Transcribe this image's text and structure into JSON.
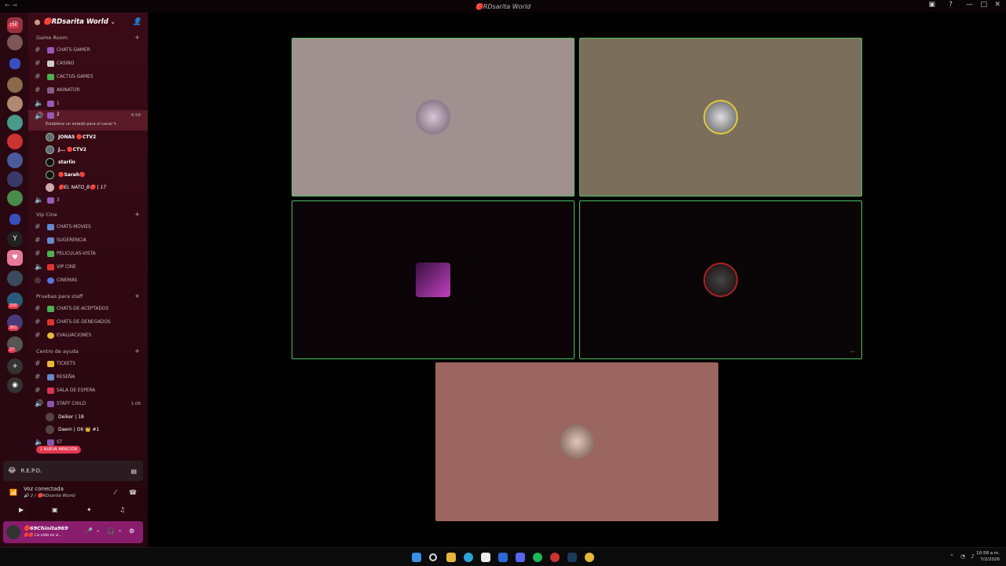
{
  "window": {
    "title": "🔴RDsarita World",
    "nav": "← →"
  },
  "server_rail": {
    "badges": [
      "156",
      "5",
      "330",
      "361",
      "27"
    ]
  },
  "sidebar": {
    "server_name": "🔴RDsarita World",
    "categories": [
      {
        "name": "Game Room",
        "channels": [
          {
            "name": "CHATS-GAMER",
            "type": "text",
            "color": "#9b59b6"
          },
          {
            "name": "CASINO",
            "type": "text",
            "color": "#cccccc"
          },
          {
            "name": "CACTUS-GAMES",
            "type": "text",
            "color": "#4caf50"
          },
          {
            "name": "AKINATOR",
            "type": "text",
            "color": "#8a5a8a"
          },
          {
            "name": "1",
            "type": "voice",
            "color": "#9b59b6"
          },
          {
            "name": "2",
            "type": "voice",
            "color": "#9b59b6",
            "active": true,
            "time": "4:58",
            "status": "Establece un estado para el canal ✎"
          }
        ]
      },
      {
        "name": "Vip Cine",
        "channels": [
          {
            "name": "CHATS-MOVIES",
            "type": "text",
            "color": "#6688cc"
          },
          {
            "name": "SUGERENCIA",
            "type": "text",
            "color": "#6688cc"
          },
          {
            "name": "PELICULAS-VISTA",
            "type": "text",
            "color": "#4caf50"
          },
          {
            "name": "VIP CINE",
            "type": "voice",
            "color": "#dd3333"
          },
          {
            "name": "CINEMAS",
            "type": "voice",
            "color": "#5577dd"
          }
        ]
      },
      {
        "name": "Pruebas para staff",
        "channels": [
          {
            "name": "CHATS-DE-ACEPTADOS",
            "type": "text",
            "color": "#4caf50"
          },
          {
            "name": "CHATS-DE-DENEGADOS",
            "type": "text",
            "color": "#dd3333"
          },
          {
            "name": "EVALUACIONES",
            "type": "text",
            "color": "#e5b83c"
          }
        ]
      },
      {
        "name": "Centro de ayuda",
        "channels": [
          {
            "name": "TICKETS",
            "type": "text",
            "color": "#e5b83c"
          },
          {
            "name": "RESEÑA",
            "type": "text",
            "color": "#6688cc"
          },
          {
            "name": "SALA DE ESPERA",
            "type": "text",
            "color": "#dd3355"
          },
          {
            "name": "STAFF CHILD",
            "type": "voice",
            "color": "#8855aa",
            "time": "1:08"
          }
        ]
      }
    ],
    "voice_users": [
      "JONAS 🔴CTV2",
      "J... 🔴CTV2",
      "starlin",
      "🔴Sarah🔴",
      "🔴EL NATO_B🔴 | 17"
    ],
    "channel_3": "3",
    "staff_users": [
      "Deiker | 18",
      "Daem | O6 👑 #1"
    ],
    "last_channel": "ST",
    "mention": "1 NUEVA MENCIÓN"
  },
  "game_activity": {
    "name": "R.E.P.O."
  },
  "voice_panel": {
    "status": "Voz conectada",
    "channel": "🔊 2 / 🔴RDsarita World"
  },
  "user_panel": {
    "name": "🔴69Chinita969",
    "status": "🔴🔴 La vida es a..."
  },
  "tiles": [
    {
      "name": "tile-1",
      "bg": "#a09090"
    },
    {
      "name": "tile-2",
      "bg": "#7b6f5b"
    },
    {
      "name": "tile-3",
      "bg": "#0b0508"
    },
    {
      "name": "tile-4",
      "bg": "#0a0607"
    },
    {
      "name": "tile-5",
      "bg": "#9c6660"
    }
  ],
  "tile_more": "...",
  "clock": {
    "time": "10:58 a.m.",
    "date": "7/2/2026"
  }
}
